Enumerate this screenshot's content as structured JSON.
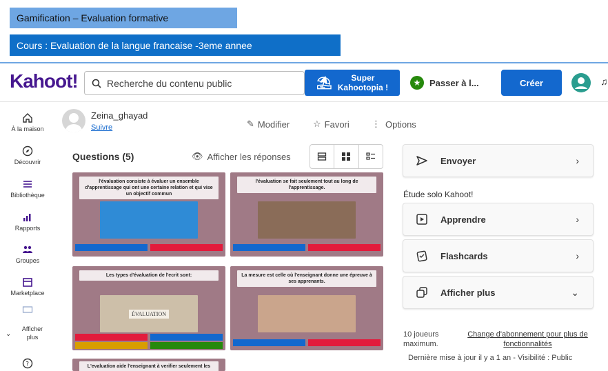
{
  "banners": {
    "line1": "Gamification – Evaluation formative",
    "line2": "Cours : Evaluation de la langue francaise -3eme annee"
  },
  "topbar": {
    "logo": "Kahoot!",
    "search_placeholder": "Recherche du contenu public",
    "super_line1": "Super",
    "super_line2": "Kahootopia !",
    "passer": "Passer à l...",
    "creer": "Créer",
    "brand_color": "#46178f",
    "accent": "#1368ce"
  },
  "sidebar": {
    "items": [
      {
        "label": "À la maison",
        "icon": "home-icon"
      },
      {
        "label": "Découvrir",
        "icon": "compass-icon"
      },
      {
        "label": "Bibliothèque",
        "icon": "list-icon"
      },
      {
        "label": "Rapports",
        "icon": "chart-icon"
      },
      {
        "label": "Groupes",
        "icon": "people-icon"
      },
      {
        "label": "Marketplace",
        "icon": "store-icon"
      },
      {
        "label": "Afficher plus",
        "icon": "chevron-down-icon"
      }
    ]
  },
  "profile": {
    "name": "Zeina_ghayad",
    "follow": "Suivre"
  },
  "actions": {
    "modifier": "Modifier",
    "favori": "Favori",
    "options": "Options"
  },
  "questions": {
    "heading": "Questions (5)",
    "show_answers": "Afficher les réponses",
    "items": [
      {
        "text": "l'évaluation consiste à évaluer un ensemble d'apprentissage qui ont une certaine relation et qui vise un objectif commun"
      },
      {
        "text": "l'évaluation se fait seulement tout au long de l'apprentissage."
      },
      {
        "text": "Les types d'évaluation de l'ecrit sont:",
        "image_text": "ÉVALUATION"
      },
      {
        "text": "La mesure est celle où l'enseignant donne une épreuve à ses apprenants."
      },
      {
        "text": "L'evaluation aide l'enseignant à verifier seulement les"
      }
    ]
  },
  "right": {
    "envoyer": "Envoyer",
    "etude": "Étude solo Kahoot!",
    "apprendre": "Apprendre",
    "flashcards": "Flashcards",
    "afficher_plus": "Afficher plus",
    "players": "10 joueurs maximum.",
    "upgrade": "Change d'abonnement pour plus de fonctionnalités",
    "updated": "Dernière mise à jour il y a 1 an - Visibilité : Public"
  }
}
